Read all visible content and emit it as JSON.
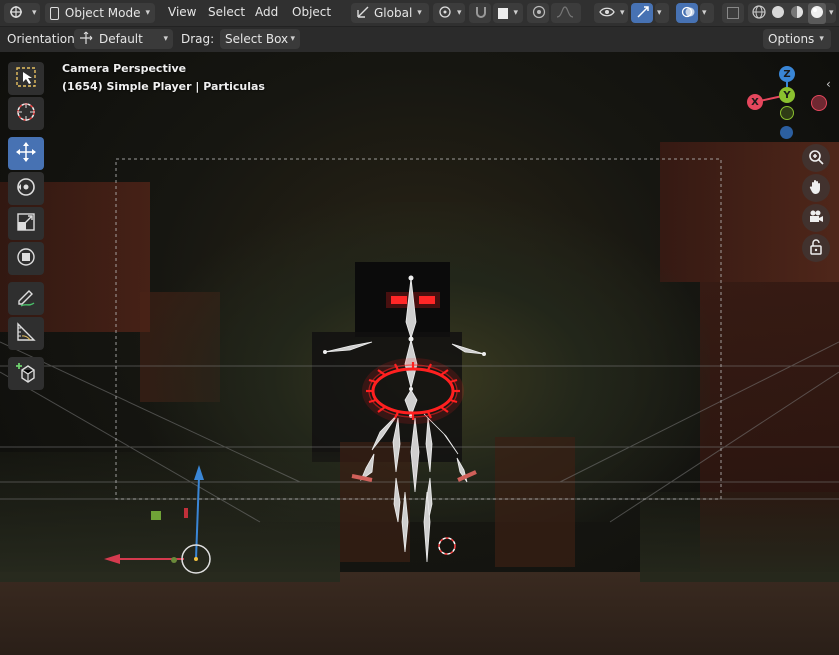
{
  "header": {
    "mode": "Object Mode",
    "menus": [
      "View",
      "Select",
      "Add",
      "Object"
    ],
    "transform_orientation": "Global",
    "shading_modes": [
      "wireframe",
      "solid",
      "material",
      "rendered"
    ]
  },
  "tool_header": {
    "orientation_label": "Orientation:",
    "orientation_value": "Default",
    "drag_label": "Drag:",
    "drag_value": "Select Box",
    "options_label": "Options"
  },
  "viewport": {
    "view_name": "Camera Perspective",
    "object_info": "(1654) Simple Player | Particulas"
  },
  "toolbar": {
    "tools": [
      "select-box",
      "cursor",
      "move",
      "rotate",
      "scale",
      "transform",
      "annotate",
      "measure",
      "add-cube"
    ],
    "active": "move"
  },
  "gizmo": {
    "axes": [
      "Z",
      "Y",
      "X"
    ],
    "colors": {
      "x": "#e5475d",
      "y": "#8ac12f",
      "z": "#3a86d6"
    }
  },
  "colors": {
    "accent": "#4772b3",
    "header_bg": "#303030",
    "glow": "#ff1e1e"
  }
}
